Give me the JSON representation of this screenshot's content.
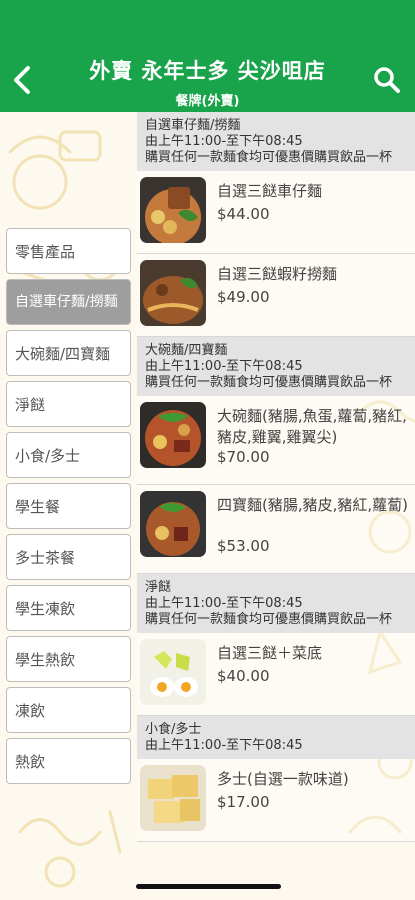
{
  "header": {
    "title": "外賣 永年士多 尖沙咀店",
    "subtitle": "餐牌(外賣)"
  },
  "sidebar": {
    "items": [
      {
        "label": "零售產品"
      },
      {
        "label": "自選車仔麵/撈麵"
      },
      {
        "label": "大碗麵/四寶麵"
      },
      {
        "label": "淨餸"
      },
      {
        "label": "小食/多士"
      },
      {
        "label": "學生餐"
      },
      {
        "label": "多士茶餐"
      },
      {
        "label": "學生凍飲"
      },
      {
        "label": "學生熱飲"
      },
      {
        "label": "凍飲"
      },
      {
        "label": "熱飲"
      }
    ],
    "active_index": 1
  },
  "sections": [
    {
      "title": "自選車仔麵/撈麵",
      "hours": "由上午11:00-至下午08:45",
      "note": "購買任何一款麵食均可優惠價購買飲品一杯",
      "items": [
        {
          "name": "自選三餸車仔麵",
          "price": "$44.00"
        },
        {
          "name": "自選三餸蝦籽撈麵",
          "price": "$49.00"
        }
      ]
    },
    {
      "title": "大碗麵/四寶麵",
      "hours": "由上午11:00-至下午08:45",
      "note": "購買任何一款麵食均可優惠價購買飲品一杯",
      "items": [
        {
          "name": "大碗麵(豬腸,魚蛋,蘿蔔,豬紅,豬皮,雞翼,雞翼尖)",
          "price": "$70.00"
        },
        {
          "name": "四寶麵(豬腸,豬皮,豬紅,蘿蔔)",
          "price": "$53.00"
        }
      ]
    },
    {
      "title": "淨餸",
      "hours": "由上午11:00-至下午08:45",
      "note": "購買任何一款麵食均可優惠價購買飲品一杯",
      "items": [
        {
          "name": "自選三餸＋菜底",
          "price": "$40.00"
        }
      ]
    },
    {
      "title": "小食/多士",
      "hours": "由上午11:00-至下午08:45",
      "items": [
        {
          "name": "多士(自選一款味道)",
          "price": "$17.00"
        }
      ]
    }
  ],
  "colors": {
    "header_green": "#19a34a",
    "sidebar_active": "#9e9e9e",
    "section_bg": "#e3e3e3",
    "page_bg": "#fdf9ee"
  },
  "icons": {
    "back": "chevron-left-icon",
    "search": "search-icon"
  }
}
